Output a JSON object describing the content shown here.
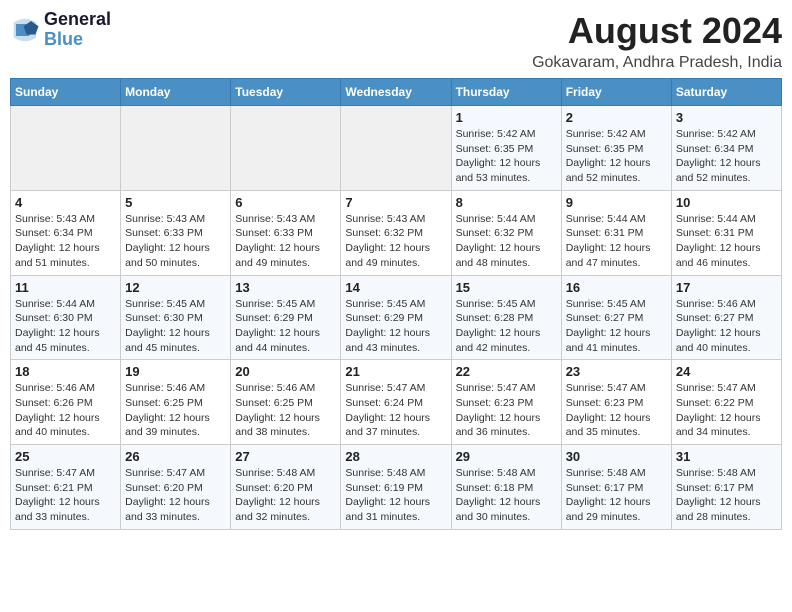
{
  "logo": {
    "line1": "General",
    "line2": "Blue"
  },
  "title": "August 2024",
  "location": "Gokavaram, Andhra Pradesh, India",
  "days_of_week": [
    "Sunday",
    "Monday",
    "Tuesday",
    "Wednesday",
    "Thursday",
    "Friday",
    "Saturday"
  ],
  "weeks": [
    [
      {
        "day": "",
        "info": ""
      },
      {
        "day": "",
        "info": ""
      },
      {
        "day": "",
        "info": ""
      },
      {
        "day": "",
        "info": ""
      },
      {
        "day": "1",
        "info": "Sunrise: 5:42 AM\nSunset: 6:35 PM\nDaylight: 12 hours\nand 53 minutes."
      },
      {
        "day": "2",
        "info": "Sunrise: 5:42 AM\nSunset: 6:35 PM\nDaylight: 12 hours\nand 52 minutes."
      },
      {
        "day": "3",
        "info": "Sunrise: 5:42 AM\nSunset: 6:34 PM\nDaylight: 12 hours\nand 52 minutes."
      }
    ],
    [
      {
        "day": "4",
        "info": "Sunrise: 5:43 AM\nSunset: 6:34 PM\nDaylight: 12 hours\nand 51 minutes."
      },
      {
        "day": "5",
        "info": "Sunrise: 5:43 AM\nSunset: 6:33 PM\nDaylight: 12 hours\nand 50 minutes."
      },
      {
        "day": "6",
        "info": "Sunrise: 5:43 AM\nSunset: 6:33 PM\nDaylight: 12 hours\nand 49 minutes."
      },
      {
        "day": "7",
        "info": "Sunrise: 5:43 AM\nSunset: 6:32 PM\nDaylight: 12 hours\nand 49 minutes."
      },
      {
        "day": "8",
        "info": "Sunrise: 5:44 AM\nSunset: 6:32 PM\nDaylight: 12 hours\nand 48 minutes."
      },
      {
        "day": "9",
        "info": "Sunrise: 5:44 AM\nSunset: 6:31 PM\nDaylight: 12 hours\nand 47 minutes."
      },
      {
        "day": "10",
        "info": "Sunrise: 5:44 AM\nSunset: 6:31 PM\nDaylight: 12 hours\nand 46 minutes."
      }
    ],
    [
      {
        "day": "11",
        "info": "Sunrise: 5:44 AM\nSunset: 6:30 PM\nDaylight: 12 hours\nand 45 minutes."
      },
      {
        "day": "12",
        "info": "Sunrise: 5:45 AM\nSunset: 6:30 PM\nDaylight: 12 hours\nand 45 minutes."
      },
      {
        "day": "13",
        "info": "Sunrise: 5:45 AM\nSunset: 6:29 PM\nDaylight: 12 hours\nand 44 minutes."
      },
      {
        "day": "14",
        "info": "Sunrise: 5:45 AM\nSunset: 6:29 PM\nDaylight: 12 hours\nand 43 minutes."
      },
      {
        "day": "15",
        "info": "Sunrise: 5:45 AM\nSunset: 6:28 PM\nDaylight: 12 hours\nand 42 minutes."
      },
      {
        "day": "16",
        "info": "Sunrise: 5:45 AM\nSunset: 6:27 PM\nDaylight: 12 hours\nand 41 minutes."
      },
      {
        "day": "17",
        "info": "Sunrise: 5:46 AM\nSunset: 6:27 PM\nDaylight: 12 hours\nand 40 minutes."
      }
    ],
    [
      {
        "day": "18",
        "info": "Sunrise: 5:46 AM\nSunset: 6:26 PM\nDaylight: 12 hours\nand 40 minutes."
      },
      {
        "day": "19",
        "info": "Sunrise: 5:46 AM\nSunset: 6:25 PM\nDaylight: 12 hours\nand 39 minutes."
      },
      {
        "day": "20",
        "info": "Sunrise: 5:46 AM\nSunset: 6:25 PM\nDaylight: 12 hours\nand 38 minutes."
      },
      {
        "day": "21",
        "info": "Sunrise: 5:47 AM\nSunset: 6:24 PM\nDaylight: 12 hours\nand 37 minutes."
      },
      {
        "day": "22",
        "info": "Sunrise: 5:47 AM\nSunset: 6:23 PM\nDaylight: 12 hours\nand 36 minutes."
      },
      {
        "day": "23",
        "info": "Sunrise: 5:47 AM\nSunset: 6:23 PM\nDaylight: 12 hours\nand 35 minutes."
      },
      {
        "day": "24",
        "info": "Sunrise: 5:47 AM\nSunset: 6:22 PM\nDaylight: 12 hours\nand 34 minutes."
      }
    ],
    [
      {
        "day": "25",
        "info": "Sunrise: 5:47 AM\nSunset: 6:21 PM\nDaylight: 12 hours\nand 33 minutes."
      },
      {
        "day": "26",
        "info": "Sunrise: 5:47 AM\nSunset: 6:20 PM\nDaylight: 12 hours\nand 33 minutes."
      },
      {
        "day": "27",
        "info": "Sunrise: 5:48 AM\nSunset: 6:20 PM\nDaylight: 12 hours\nand 32 minutes."
      },
      {
        "day": "28",
        "info": "Sunrise: 5:48 AM\nSunset: 6:19 PM\nDaylight: 12 hours\nand 31 minutes."
      },
      {
        "day": "29",
        "info": "Sunrise: 5:48 AM\nSunset: 6:18 PM\nDaylight: 12 hours\nand 30 minutes."
      },
      {
        "day": "30",
        "info": "Sunrise: 5:48 AM\nSunset: 6:17 PM\nDaylight: 12 hours\nand 29 minutes."
      },
      {
        "day": "31",
        "info": "Sunrise: 5:48 AM\nSunset: 6:17 PM\nDaylight: 12 hours\nand 28 minutes."
      }
    ]
  ]
}
